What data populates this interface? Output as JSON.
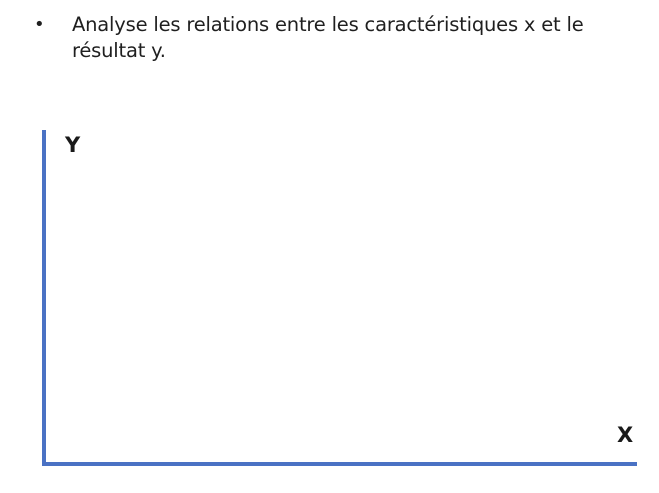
{
  "slide": {
    "bullets": [
      {
        "text": "Analyse les relations entre les caractéristiques x et le résultat y."
      }
    ]
  },
  "diagram": {
    "y_axis_label": "Y",
    "x_axis_label": "X",
    "axis_color": "#4a72c4"
  }
}
